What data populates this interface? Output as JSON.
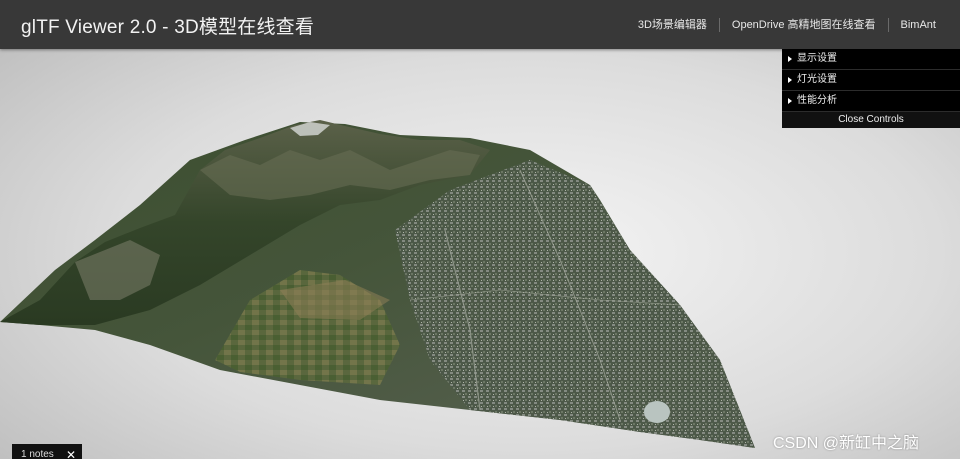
{
  "header": {
    "title": "glTF Viewer 2.0 - 3D模型在线查看",
    "nav": [
      "3D场景编辑器",
      "OpenDrive 高精地图在线查看",
      "BimAnt"
    ]
  },
  "controls": {
    "folders": [
      "显示设置",
      "灯光设置",
      "性能分析"
    ],
    "close_label": "Close Controls"
  },
  "notes": {
    "label": "1 notes",
    "close_glyph": "✕"
  },
  "watermark": "CSDN @新缸中之脑",
  "colors": {
    "topbar": "#383838",
    "panel": "#000000",
    "terrain_dark": "#2b3a22",
    "terrain_mid": "#44563a",
    "urban": "#6d7668"
  }
}
